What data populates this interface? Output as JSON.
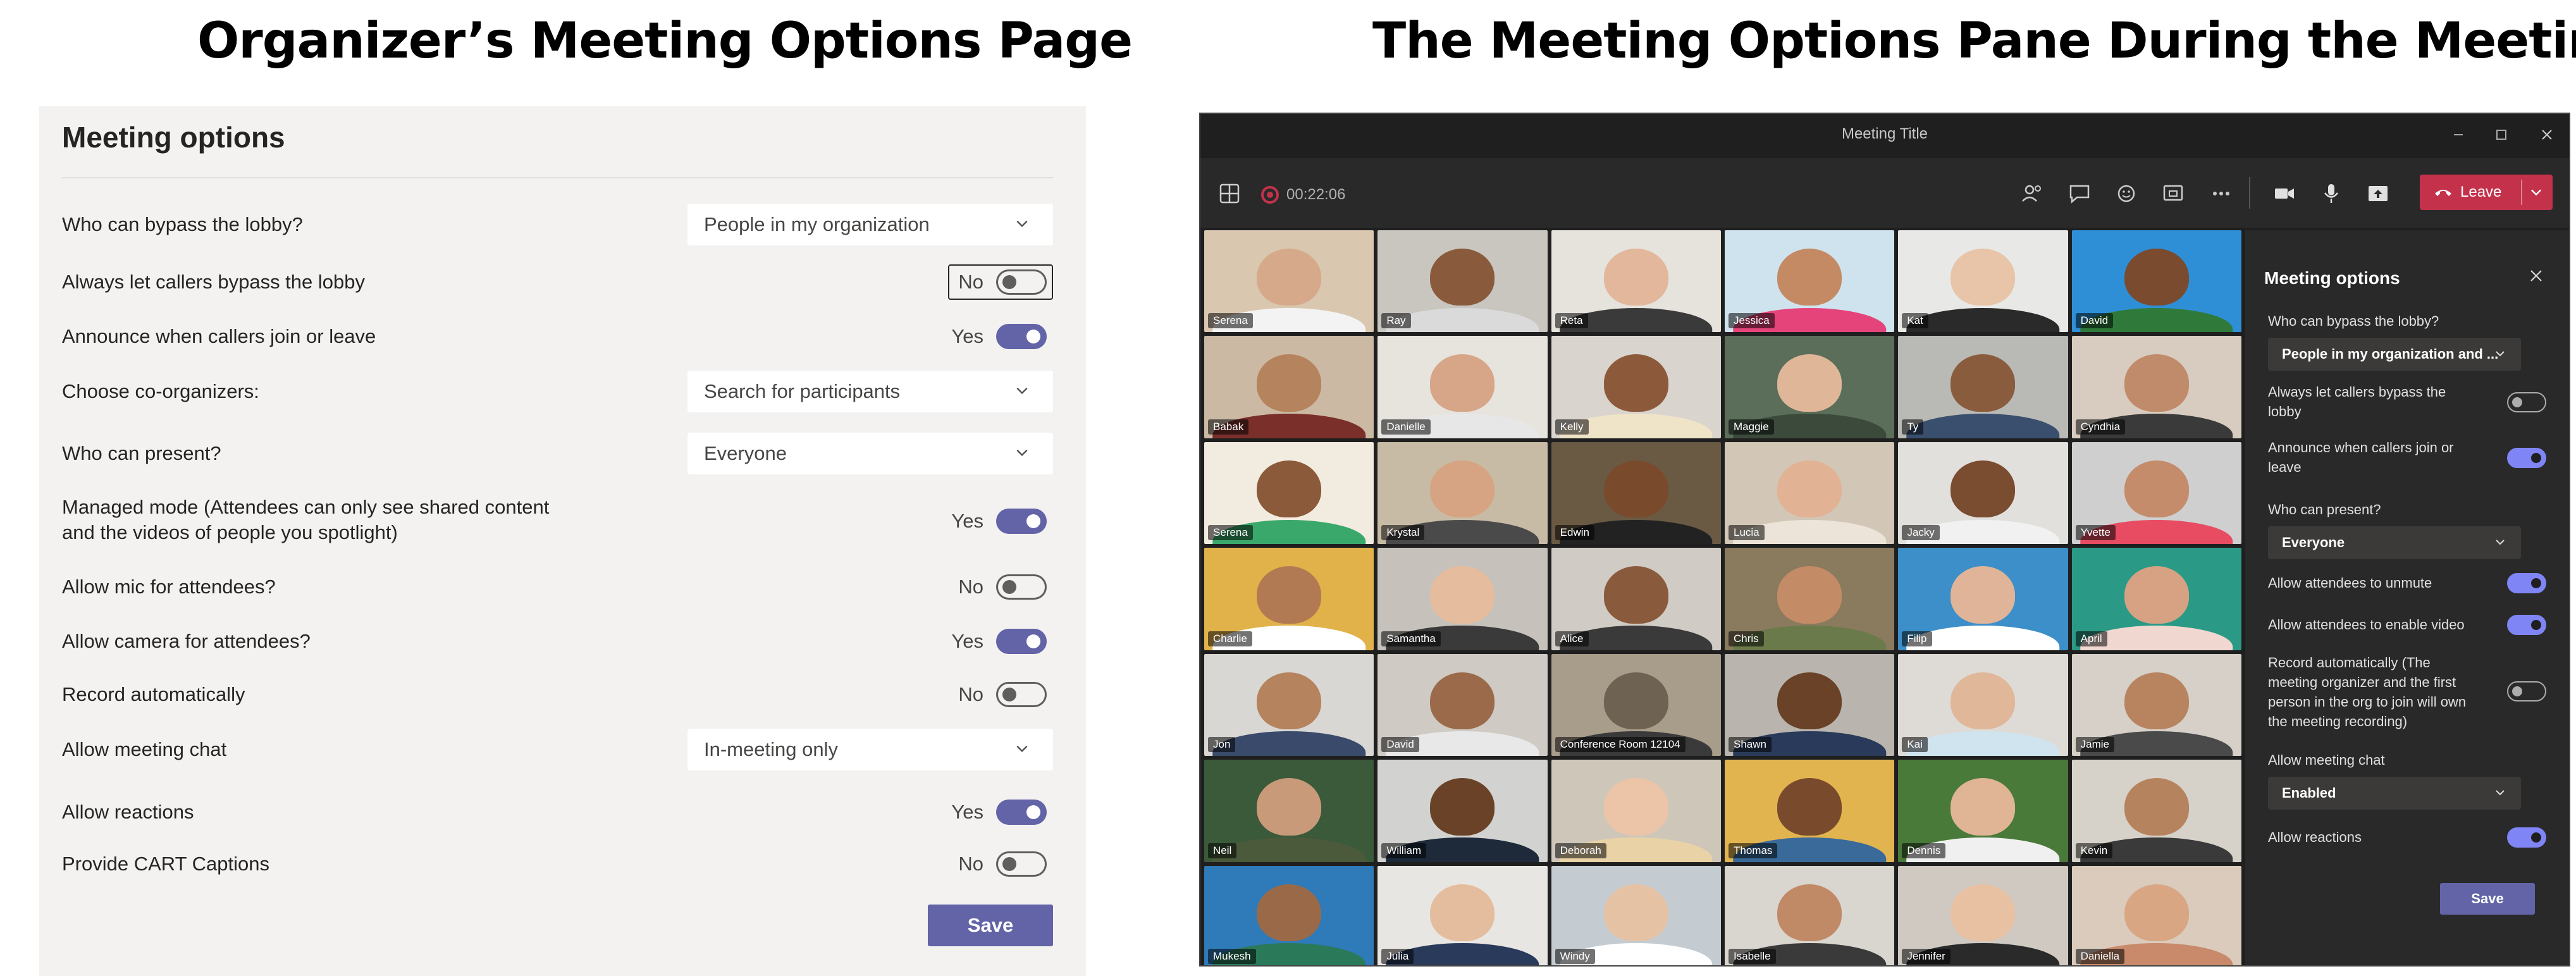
{
  "headings": {
    "left": "Organizer’s Meeting Options Page",
    "right": "The Meeting Options Pane During the Meeting"
  },
  "organizer_page": {
    "title": "Meeting options",
    "options": [
      {
        "label": "Who can bypass the lobby?",
        "value": "People in my organization"
      },
      {
        "label": "Always let callers bypass the lobby",
        "value": "No",
        "on": false
      },
      {
        "label": "Announce when callers join or leave",
        "value": "Yes",
        "on": true
      },
      {
        "label": "Choose co-organizers:",
        "placeholder": "Search for participants"
      },
      {
        "label": "Who can present?",
        "value": "Everyone"
      },
      {
        "label_line1": "Managed mode (Attendees can only see shared content",
        "label_line2": "and the videos of people you spotlight)",
        "value": "Yes",
        "on": true
      },
      {
        "label": "Allow mic for attendees?",
        "value": "No",
        "on": false
      },
      {
        "label": "Allow camera for attendees?",
        "value": "Yes",
        "on": true
      },
      {
        "label": "Record automatically",
        "value": "No",
        "on": false
      },
      {
        "label": "Allow meeting chat",
        "value": "In-meeting only"
      },
      {
        "label": "Allow reactions",
        "value": "Yes",
        "on": true
      },
      {
        "label": "Provide CART Captions",
        "value": "No",
        "on": false
      }
    ],
    "save_label": "Save"
  },
  "meeting_window": {
    "title": "Meeting Title",
    "timer": "00:22:06",
    "leave_label": "Leave",
    "colors": {
      "leave": "#c4314b",
      "accent": "#6264a7"
    },
    "toolbar_icons": [
      "participants-icon",
      "chat-icon",
      "reactions-icon",
      "share-tray-icon",
      "more-icon",
      "camera-icon",
      "mic-icon",
      "share-icon"
    ],
    "participants": [
      {
        "name": "Serena",
        "bg": "#d9c7b0",
        "skin": "#d6a98a",
        "shirt": "#f3f3f3"
      },
      {
        "name": "Ray",
        "bg": "#c9c6c0",
        "skin": "#8a5a3c",
        "shirt": "#dadada"
      },
      {
        "name": "Reta",
        "bg": "#e6e2dc",
        "skin": "#e2b79c",
        "shirt": "#3a3a3a"
      },
      {
        "name": "Jessica",
        "bg": "#cfe3ef",
        "skin": "#c48a64",
        "shirt": "#e4447a"
      },
      {
        "name": "Kat",
        "bg": "#e8e8e6",
        "skin": "#e8c4a8",
        "shirt": "#2a2a2a"
      },
      {
        "name": "David",
        "bg": "#2e8fd6",
        "skin": "#7a4b2e",
        "shirt": "#2f7a3a"
      },
      {
        "name": "Babak",
        "bg": "#cbb9a3",
        "skin": "#b5835e",
        "shirt": "#7a2f2a"
      },
      {
        "name": "Danielle",
        "bg": "#e7e3dd",
        "skin": "#d7a587",
        "shirt": "#e7e7e7"
      },
      {
        "name": "Kelly",
        "bg": "#d9d4ce",
        "skin": "#8c5a3a",
        "shirt": "#f0e4c8"
      },
      {
        "name": "Maggie",
        "bg": "#5a6e5a",
        "skin": "#e0b699",
        "shirt": "#3c4a3c"
      },
      {
        "name": "Ty",
        "bg": "#b9b9b6",
        "skin": "#8a5c3e",
        "shirt": "#3a4e6e"
      },
      {
        "name": "Cyndhia",
        "bg": "#d8ccc0",
        "skin": "#c08b6a",
        "shirt": "#3a3a3a"
      },
      {
        "name": "Serena",
        "bg": "#f2ece0",
        "skin": "#8a5a3a",
        "shirt": "#3aa86a"
      },
      {
        "name": "Krystal",
        "bg": "#c8bba6",
        "skin": "#d6a483",
        "shirt": "#4a4a4a"
      },
      {
        "name": "Edwin",
        "bg": "#6a5a44",
        "skin": "#7a4a2c",
        "shirt": "#222222"
      },
      {
        "name": "Lucia",
        "bg": "#d2c6b6",
        "skin": "#e2b295",
        "shirt": "#ece4d8"
      },
      {
        "name": "Jacky",
        "bg": "#e2e0dc",
        "skin": "#7a4c30",
        "shirt": "#f1f1f1"
      },
      {
        "name": "Yvette",
        "bg": "#cfcfcf",
        "skin": "#c48c6a",
        "shirt": "#e74c62"
      },
      {
        "name": "Charlie",
        "bg": "#e2b24a",
        "skin": "#b27a52",
        "shirt": "#ffffff"
      },
      {
        "name": "Samantha",
        "bg": "#c6c2bb",
        "skin": "#e6bc9e",
        "shirt": "#3a3a3a"
      },
      {
        "name": "Alice",
        "bg": "#d0cbc4",
        "skin": "#8a5a3c",
        "shirt": "#3a3a3a"
      },
      {
        "name": "Chris",
        "bg": "#8a7a5e",
        "skin": "#c48c66",
        "shirt": "#6a7a4a"
      },
      {
        "name": "Filip",
        "bg": "#3c8fc8",
        "skin": "#e0b498",
        "shirt": "#ffffff"
      },
      {
        "name": "April",
        "bg": "#2a9a86",
        "skin": "#d6a283",
        "shirt": "#f0d8d0"
      },
      {
        "name": "Jon",
        "bg": "#d9d7d3",
        "skin": "#b5835e",
        "shirt": "#3a4a6a"
      },
      {
        "name": "David",
        "bg": "#cfcac3",
        "skin": "#9a6a4a",
        "shirt": "#e8e8e8"
      },
      {
        "name": "Conference Room 12104",
        "bg": "#a89c8a",
        "skin": "#6e6252",
        "shirt": "#3a3a3a"
      },
      {
        "name": "Shawn",
        "bg": "#b9b5ae",
        "skin": "#6a4228",
        "shirt": "#2a3a5a"
      },
      {
        "name": "Kai",
        "bg": "#dedbd6",
        "skin": "#e0b899",
        "shirt": "#cfe4ef"
      },
      {
        "name": "Jamie",
        "bg": "#d6d0c8",
        "skin": "#b88460",
        "shirt": "#4a4a4a"
      },
      {
        "name": "Neil",
        "bg": "#3a5a3a",
        "skin": "#c89a7a",
        "shirt": "#4a5a3a"
      },
      {
        "name": "William",
        "bg": "#d2d2d0",
        "skin": "#6a4228",
        "shirt": "#1e2a3a"
      },
      {
        "name": "Deborah",
        "bg": "#cfc6ba",
        "skin": "#ecc4a8",
        "shirt": "#e9d2a6"
      },
      {
        "name": "Thomas",
        "bg": "#e2b450",
        "skin": "#7a4a2c",
        "shirt": "#3a6a9a"
      },
      {
        "name": "Dennis",
        "bg": "#4a7a3a",
        "skin": "#e0b596",
        "shirt": "#f0f0f0"
      },
      {
        "name": "Kevin",
        "bg": "#d6d2ca",
        "skin": "#b5835e",
        "shirt": "#3a3a3a"
      },
      {
        "name": "Mukesh",
        "bg": "#2f7ab9",
        "skin": "#9a6a48",
        "shirt": "#2a7a5a"
      },
      {
        "name": "Julia",
        "bg": "#e8e6e2",
        "skin": "#e4bc9e",
        "shirt": "#2a3a5a"
      },
      {
        "name": "Windy",
        "bg": "#c4ccd2",
        "skin": "#e6c2a4",
        "shirt": "#ffffff"
      },
      {
        "name": "Isabelle",
        "bg": "#d9d5cf",
        "skin": "#c08a66",
        "shirt": "#3a3a3a"
      },
      {
        "name": "Jennifer",
        "bg": "#cfc9c1",
        "skin": "#e8c0a2",
        "shirt": "#2a2a2a"
      },
      {
        "name": "Daniella",
        "bg": "#dacbbd",
        "skin": "#d9a684",
        "shirt": "#c88a6a"
      }
    ],
    "options_pane": {
      "title": "Meeting options",
      "lobby_label": "Who can bypass the lobby?",
      "lobby_value": "People in my organization and ...",
      "callers_bypass_line1": "Always let callers bypass the",
      "callers_bypass_line2": "lobby",
      "callers_bypass_on": false,
      "announce_line1": "Announce when callers join or",
      "announce_line2": "leave",
      "announce_on": true,
      "present_label": "Who can present?",
      "present_value": "Everyone",
      "unmute_label": "Allow attendees to unmute",
      "unmute_on": true,
      "video_label": "Allow attendees to enable video",
      "video_on": true,
      "record_line1": "Record automatically (The",
      "record_line2": "meeting organizer and the first",
      "record_line3": "person in the org to join will own",
      "record_line4": "the meeting recording)",
      "record_on": false,
      "chat_label": "Allow meeting chat",
      "chat_value": "Enabled",
      "reactions_label": "Allow reactions",
      "reactions_on": true,
      "save_label": "Save"
    }
  }
}
